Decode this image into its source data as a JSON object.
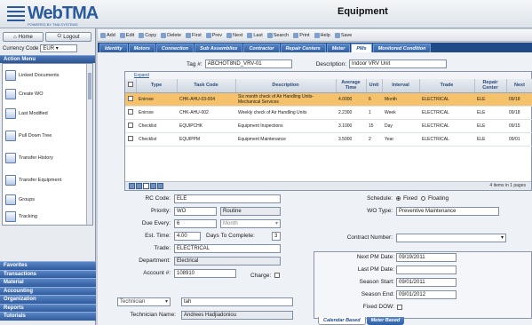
{
  "brand": {
    "name": "WebTMA",
    "tagline": "POWERED BY TMA SYSTEMS"
  },
  "page_title": "Equipment",
  "nav": {
    "home": "Home",
    "logout": "Logout"
  },
  "currency": {
    "label": "Currency Code",
    "value": "EUR"
  },
  "action_menu": {
    "title": "Action Menu",
    "items": [
      "Linked Documents",
      "Create WO",
      "Last Modified",
      "Pull Down Tree",
      "Transfer History",
      "Transfer Equipment",
      "Groups",
      "Tracking"
    ]
  },
  "categories": [
    "Favorites",
    "Transactions",
    "Material",
    "Accounting",
    "Organization",
    "Reports",
    "Tutorials"
  ],
  "toolbar": [
    "Add",
    "Edit",
    "Copy",
    "Delete",
    "First",
    "Prev",
    "Next",
    "Last",
    "Search",
    "Print",
    "Help",
    "Save"
  ],
  "tabs": [
    "Identity",
    "Motors",
    "Connection",
    "Sub Assemblies",
    "Contractor",
    "Repair Centers",
    "Meter",
    "PMs",
    "Monitored Condition"
  ],
  "active_tab": "PMs",
  "tag": {
    "label": "Tag #:",
    "value": "ABCHOT8ND_VRV-01"
  },
  "description": {
    "label": "Description:",
    "value": "Indoor VRV Unit"
  },
  "grid": {
    "expand": "Expand",
    "columns": [
      "Type",
      "Task Code",
      "Description",
      "Average Time",
      "Unit",
      "Interval",
      "Trade",
      "Repair Center",
      "Next"
    ],
    "rows": [
      {
        "type": "Eniroxe",
        "task_code": "CHK-AHU-03-004",
        "desc": "Six month check of Air Handling Units- Mechanical Services",
        "avg": "4.0000",
        "unit": "6",
        "interval": "Month",
        "trade": "ELECTRICAL",
        "rc": "ELE",
        "next": "09/18"
      },
      {
        "type": "Eniroxe",
        "task_code": "CHK-AHU-002",
        "desc": "Weekly check of Air Handling Units",
        "avg": "2.2300",
        "unit": "1",
        "interval": "Week",
        "trade": "ELECTRICAL",
        "rc": "ELE",
        "next": "09/18"
      },
      {
        "type": "Checklist",
        "task_code": "EQUIPCHK",
        "desc": "Equipment Inspections",
        "avg": "3.1000",
        "unit": "15",
        "interval": "Day",
        "trade": "ELECTRICAL",
        "rc": "ELE",
        "next": "09/15"
      },
      {
        "type": "Checklist",
        "task_code": "EQUIPPM",
        "desc": "Equipment Maintenance",
        "avg": "3.5000",
        "unit": "2",
        "interval": "Year",
        "trade": "ELECTRICAL",
        "rc": "ELE",
        "next": "09/01"
      }
    ],
    "pager": "4 items in 1 pages"
  },
  "form": {
    "rc_code": {
      "label": "RC Code:",
      "value": "ELE"
    },
    "priority": {
      "label": "Priority:",
      "value": "WO",
      "text": "Routine"
    },
    "due_every": {
      "label": "Due Every:",
      "value": "6",
      "unit": "Month"
    },
    "est_time": {
      "label": "Est. Time:",
      "value": "4.00",
      "dtc_label": "Days To Complete:",
      "dtc": "3"
    },
    "trade": {
      "label": "Trade:",
      "value": "ELECTRICAL"
    },
    "department": {
      "label": "Department:",
      "value": "Electrical"
    },
    "account": {
      "label": "Account #:",
      "value": "108910",
      "charge": "Charge:"
    },
    "technician": {
      "sel": "Technician",
      "value": "tah"
    },
    "tech_name": {
      "label": "Technician Name:",
      "value": "Andrees Hadjiadoniou"
    },
    "schedule": {
      "label": "Schedule:",
      "fixed": "Fixed",
      "floating": "Floating"
    },
    "wo_type": {
      "label": "WO Type:",
      "value": "Preventive Maintenance"
    },
    "contract": {
      "label": "Contract Number:"
    },
    "next_pm": {
      "label": "Next PM Date:",
      "value": "09/19/2011"
    },
    "last_pm": {
      "label": "Last PM Date:",
      "value": ""
    },
    "season_start": {
      "label": "Season Start:",
      "value": "09/01/2011"
    },
    "season_end": {
      "label": "Season End:",
      "value": "09/01/2012"
    },
    "fixed_dow": {
      "label": "Fixed DOW:"
    },
    "btabs": [
      "Calendar Based",
      "Meter Based"
    ]
  }
}
